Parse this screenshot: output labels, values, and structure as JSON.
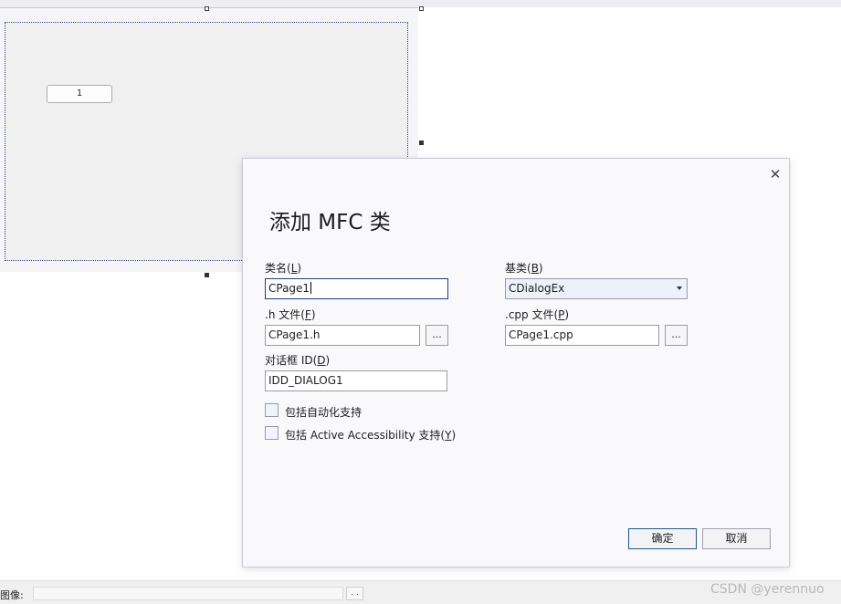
{
  "designer": {
    "canvas_button_label": "1"
  },
  "bottom_bar": {
    "image_label": "图像:",
    "browse_label": ". ."
  },
  "watermark": "CSDN @yerennuo",
  "dialog": {
    "title": "添加 MFC 类",
    "close_glyph": "✕",
    "class_name": {
      "label_text": "类名(",
      "label_mnemonic": "L",
      "label_end": ")",
      "value": "CPage1"
    },
    "base_class": {
      "label_text": "基类(",
      "label_mnemonic": "B",
      "label_end": ")",
      "value": "CDialogEx"
    },
    "h_file": {
      "label_text": ".h 文件(",
      "label_mnemonic": "F",
      "label_end": ")",
      "value": "CPage1.h",
      "browse_label": "..."
    },
    "cpp_file": {
      "label_text": ".cpp 文件(",
      "label_mnemonic": "P",
      "label_end": ")",
      "value": "CPage1.cpp",
      "browse_label": "..."
    },
    "dialog_id": {
      "label_text": "对话框 ID(",
      "label_mnemonic": "D",
      "label_end": ")",
      "value": "IDD_DIALOG1"
    },
    "automation_checkbox": {
      "label": "包括自动化支持",
      "checked": false
    },
    "accessibility_checkbox": {
      "label_text": "包括 Active Accessibility 支持(",
      "label_mnemonic": "Y",
      "label_end": ")",
      "checked": false
    },
    "ok_label": "确定",
    "cancel_label": "取消"
  },
  "colors": {
    "focus_border": "#1f3f7a",
    "dialog_bg": "#f9f9fb",
    "canvas_bg": "#f0f0f0"
  }
}
